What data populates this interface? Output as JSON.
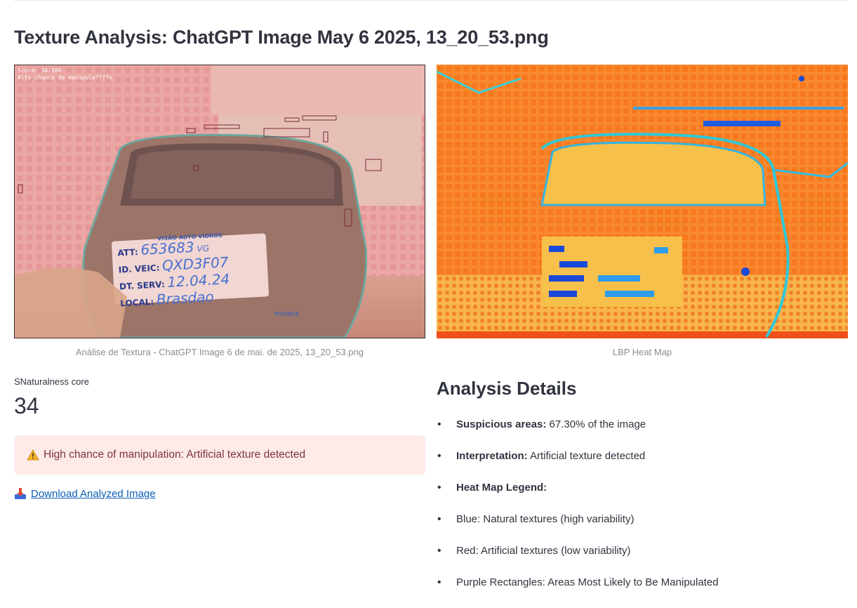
{
  "page": {
    "title": "Texture Analysis: ChatGPT Image May 6 2025, 13_20_53.png"
  },
  "overlay_image": {
    "stamp_line1": "Score: 34/100",
    "stamp_line2": "Alto chance de manipula????o",
    "card": {
      "header": "VISÃO AUTO VIDROS",
      "rows": [
        {
          "label": "ATT:",
          "value": "653683",
          "suffix": "VG"
        },
        {
          "label": "ID. VEIC:",
          "value": "QXD3F07"
        },
        {
          "label": "DT. SERV:",
          "value": "12.04.24"
        },
        {
          "label": "LOCAL:",
          "value": "Brasdao"
        }
      ]
    },
    "badge": "PREMIER",
    "caption": "Análise de Textura - ChatGPT Image 6 de mai. de 2025, 13_20_53.png"
  },
  "heatmap": {
    "caption": "LBP Heat Map"
  },
  "metric": {
    "label": "SNaturalness core",
    "value": "34"
  },
  "alert": {
    "icon": "warning-icon",
    "text": "High chance of manipulation: Artificial texture detected",
    "bg_color": "#ffeaea"
  },
  "download": {
    "icon": "download-icon",
    "label": "Download Analyzed Image"
  },
  "details": {
    "title": "Analysis Details",
    "items": [
      {
        "bold": "Suspicious areas:",
        "text": " 67.30% of the image"
      },
      {
        "bold": "Interpretation:",
        "text": " Artificial texture detected"
      },
      {
        "bold": "Heat Map Legend:",
        "text": ""
      },
      {
        "bold": "",
        "text": "Blue: Natural textures (high variability)"
      },
      {
        "bold": "",
        "text": "Red: Artificial textures (low variability)"
      },
      {
        "bold": "",
        "text": "Purple Rectangles: Areas Most Likely to Be Manipulated"
      }
    ]
  }
}
